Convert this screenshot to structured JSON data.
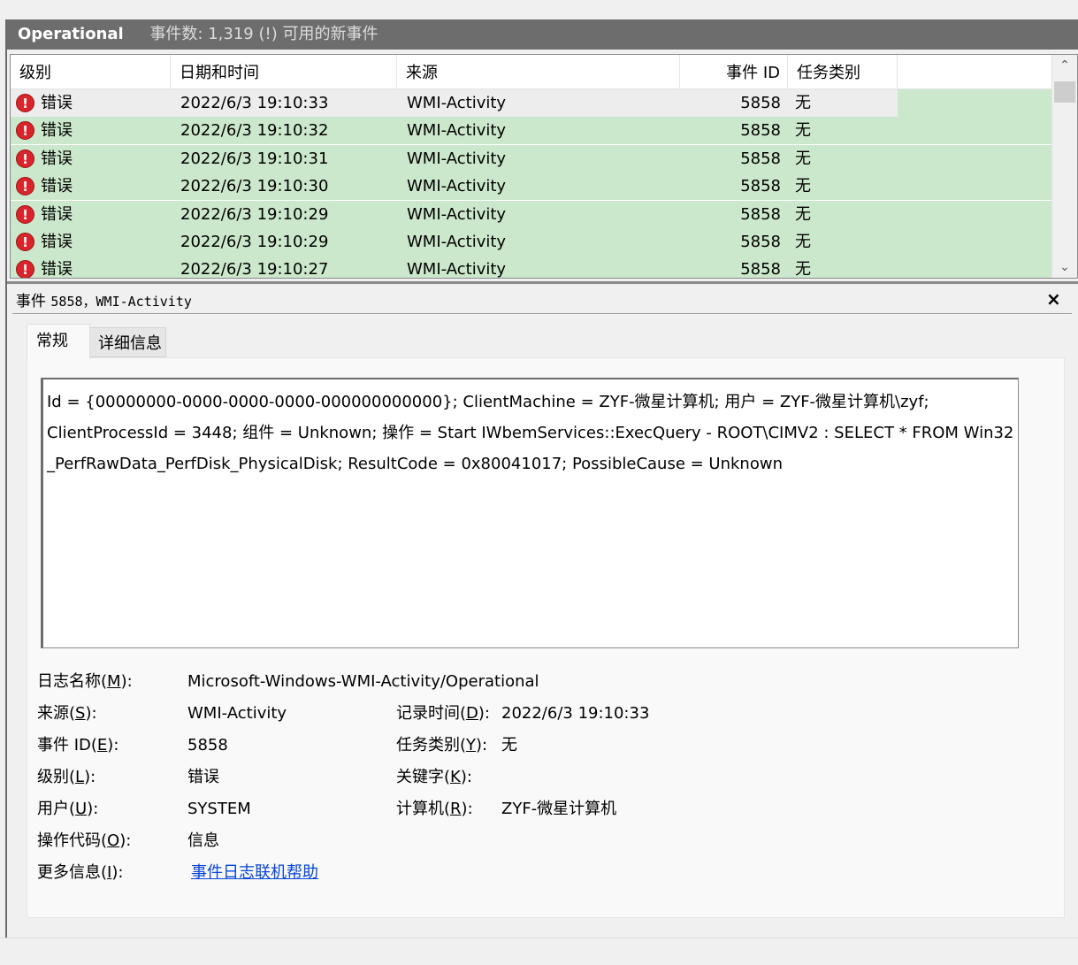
{
  "header": {
    "log_name": "Operational",
    "event_count": "事件数: 1,319 (!) 可用的新事件"
  },
  "columns": [
    "级别",
    "日期和时间",
    "来源",
    "事件 ID",
    "任务类别"
  ],
  "rows": [
    {
      "level": "错误",
      "datetime": "2022/6/3 19:10:33",
      "source": "WMI-Activity",
      "event_id": "5858",
      "task": "无"
    },
    {
      "level": "错误",
      "datetime": "2022/6/3 19:10:32",
      "source": "WMI-Activity",
      "event_id": "5858",
      "task": "无"
    },
    {
      "level": "错误",
      "datetime": "2022/6/3 19:10:31",
      "source": "WMI-Activity",
      "event_id": "5858",
      "task": "无"
    },
    {
      "level": "错误",
      "datetime": "2022/6/3 19:10:30",
      "source": "WMI-Activity",
      "event_id": "5858",
      "task": "无"
    },
    {
      "level": "错误",
      "datetime": "2022/6/3 19:10:29",
      "source": "WMI-Activity",
      "event_id": "5858",
      "task": "无"
    },
    {
      "level": "错误",
      "datetime": "2022/6/3 19:10:29",
      "source": "WMI-Activity",
      "event_id": "5858",
      "task": "无"
    },
    {
      "level": "错误",
      "datetime": "2022/6/3 19:10:27",
      "source": "WMI-Activity",
      "event_id": "5858",
      "task": "无"
    }
  ],
  "detail": {
    "title_prefix": "事件",
    "title_rest": "5858，WMI-Activity",
    "close": "×",
    "tabs": [
      "常规",
      "详细信息"
    ],
    "message_lines": [
      "Id = {00000000-0000-0000-0000-000000000000}; ClientMachine = ZYF-微星计算机; 用户 = ZYF-微星计算机\\zyf;",
      "ClientProcessId = 3448; 组件 = Unknown; 操作 = Start IWbemServices::ExecQuery - ROOT\\CIMV2 : SELECT * FROM Win32",
      "_PerfRawData_PerfDisk_PhysicalDisk; ResultCode = 0x80041017; PossibleCause = Unknown"
    ],
    "props": {
      "log_name_label_pre": "日志名称(",
      "log_name_label_key": "M",
      "log_name_label_post": "):",
      "log_name_value": "Microsoft-Windows-WMI-Activity/Operational",
      "source_label_pre": "来源(",
      "source_label_key": "S",
      "source_label_post": "):",
      "source_value": "WMI-Activity",
      "logged_label_pre": "记录时间(",
      "logged_label_key": "D",
      "logged_label_post": "):",
      "logged_value": "2022/6/3 19:10:33",
      "eventid_label_pre": "事件 ID(",
      "eventid_label_key": "E",
      "eventid_label_post": "):",
      "eventid_value": "5858",
      "task_label_pre": "任务类别(",
      "task_label_key": "Y",
      "task_label_post": "):",
      "task_value": "无",
      "level_label_pre": "级别(",
      "level_label_key": "L",
      "level_label_post": "):",
      "level_value": "错误",
      "keywords_label_pre": "关键字(",
      "keywords_label_key": "K",
      "keywords_label_post": "):",
      "user_label_pre": "用户(",
      "user_label_key": "U",
      "user_label_post": "):",
      "user_value": "SYSTEM",
      "computer_label_pre": "计算机(",
      "computer_label_key": "R",
      "computer_label_post": "):",
      "computer_value": "ZYF-微星计算机",
      "opcode_label_pre": "操作代码(",
      "opcode_label_key": "O",
      "opcode_label_post": "):",
      "opcode_value": "信息",
      "moreinfo_label_pre": "更多信息(",
      "moreinfo_label_key": "I",
      "moreinfo_label_post": "):",
      "moreinfo_link": "事件日志联机帮助"
    }
  }
}
